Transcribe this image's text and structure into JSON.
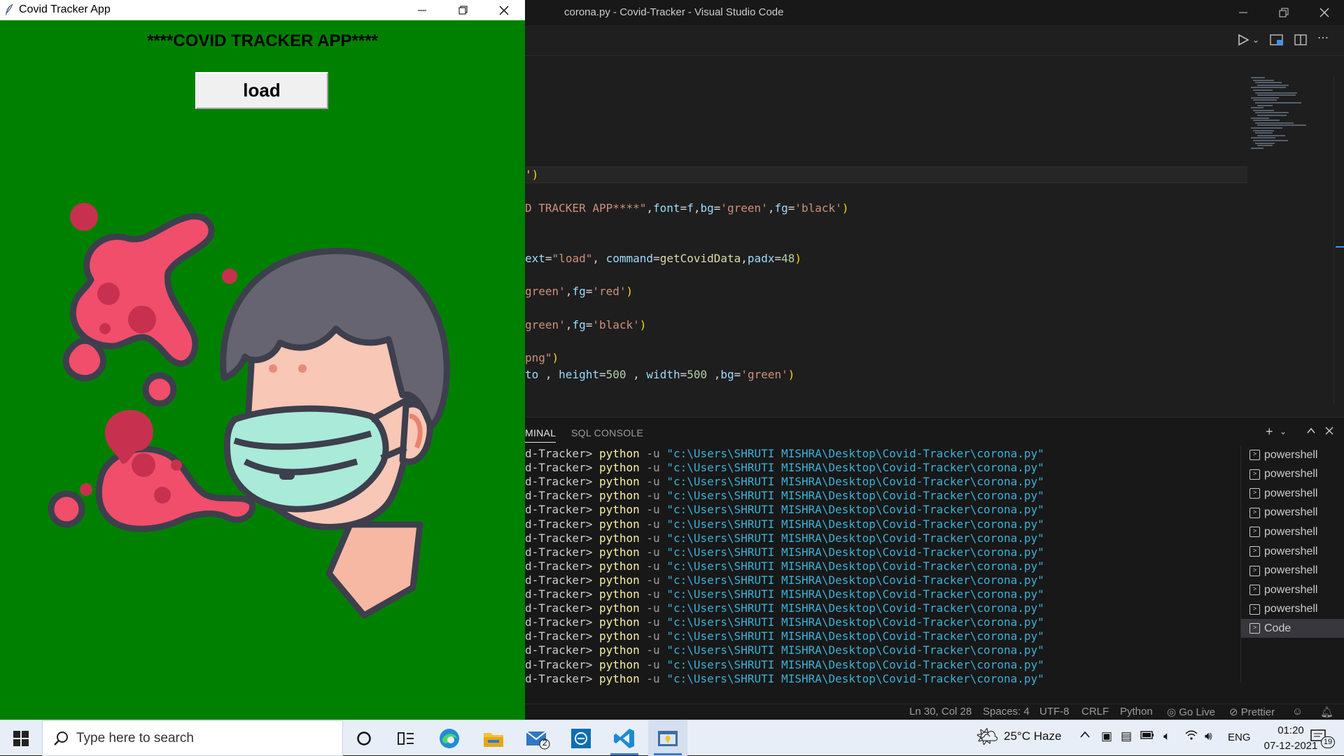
{
  "vscode": {
    "title": "corona.py - Covid-Tracker - Visual Studio Code",
    "code_lines": [
      {
        "parts": [
          [
            "')",
            "p"
          ]
        ]
      },
      {
        "parts": [
          [
            "D TRACKER APP****\"",
            "s"
          ],
          [
            ",",
            "w"
          ],
          [
            "font",
            "v"
          ],
          [
            "=",
            "w"
          ],
          [
            "f",
            "v"
          ],
          [
            ",",
            "w"
          ],
          [
            "bg",
            "v"
          ],
          [
            "=",
            "w"
          ],
          [
            "'green'",
            "s"
          ],
          [
            ",",
            "w"
          ],
          [
            "fg",
            "v"
          ],
          [
            "=",
            "w"
          ],
          [
            "'black'",
            "s"
          ],
          [
            ")",
            "p"
          ]
        ]
      },
      {
        "parts": [
          [
            "ext",
            "v"
          ],
          [
            "=",
            "w"
          ],
          [
            "\"load\"",
            "s"
          ],
          [
            ", ",
            "w"
          ],
          [
            "command",
            "v"
          ],
          [
            "=",
            "w"
          ],
          [
            "getCovidData",
            "f"
          ],
          [
            ",",
            "w"
          ],
          [
            "padx",
            "v"
          ],
          [
            "=",
            "w"
          ],
          [
            "48",
            "n"
          ],
          [
            ")",
            "p"
          ]
        ]
      },
      {
        "parts": [
          [
            "green'",
            "s"
          ],
          [
            ",",
            "w"
          ],
          [
            "fg",
            "v"
          ],
          [
            "=",
            "w"
          ],
          [
            "'red'",
            "s"
          ],
          [
            ")",
            "p"
          ]
        ]
      },
      {
        "parts": [
          [
            "green'",
            "s"
          ],
          [
            ",",
            "w"
          ],
          [
            "fg",
            "v"
          ],
          [
            "=",
            "w"
          ],
          [
            "'black'",
            "s"
          ],
          [
            ")",
            "p"
          ]
        ]
      },
      {
        "parts": [
          [
            "png\"",
            "s"
          ],
          [
            ")",
            "p"
          ]
        ]
      },
      {
        "parts": [
          [
            "to ",
            "v"
          ],
          [
            ", ",
            "w"
          ],
          [
            "height",
            "v"
          ],
          [
            "=",
            "w"
          ],
          [
            "500",
            "n"
          ],
          [
            " , ",
            "w"
          ],
          [
            "width",
            "v"
          ],
          [
            "=",
            "w"
          ],
          [
            "500",
            "n"
          ],
          [
            " ,",
            "w"
          ],
          [
            "bg",
            "v"
          ],
          [
            "=",
            "w"
          ],
          [
            "'green'",
            "s"
          ],
          [
            ")",
            "p"
          ]
        ]
      }
    ],
    "panel": {
      "tabs": [
        "MINAL",
        "SQL CONSOLE"
      ],
      "terminal_prefix": "d-Tracker>",
      "terminal_cmd": "python",
      "terminal_flag": "-u",
      "terminal_path": "\"c:\\Users\\SHRUTI MISHRA\\Desktop\\Covid-Tracker\\corona.py\"",
      "terminal_line_count": 17,
      "terminals": [
        "powershell",
        "powershell",
        "powershell",
        "powershell",
        "powershell",
        "powershell",
        "powershell",
        "powershell",
        "powershell",
        "Code"
      ]
    },
    "status": {
      "position": "Ln 30, Col 28",
      "spaces": "Spaces: 4",
      "encoding": "UTF-8",
      "eol": "CRLF",
      "language": "Python",
      "golive": "Go Live",
      "prettier": "Prettier"
    }
  },
  "tk_app": {
    "title": "Covid Tracker App",
    "heading": "****COVID TRACKER APP****",
    "button_label": "load",
    "background_color": "#008000"
  },
  "taskbar": {
    "search_placeholder": "Type here to search",
    "mail_badge": "2",
    "weather": "25°C  Haze",
    "language": "ENG",
    "time": "01:20",
    "date": "07-12-2021",
    "notification_count": "19"
  }
}
